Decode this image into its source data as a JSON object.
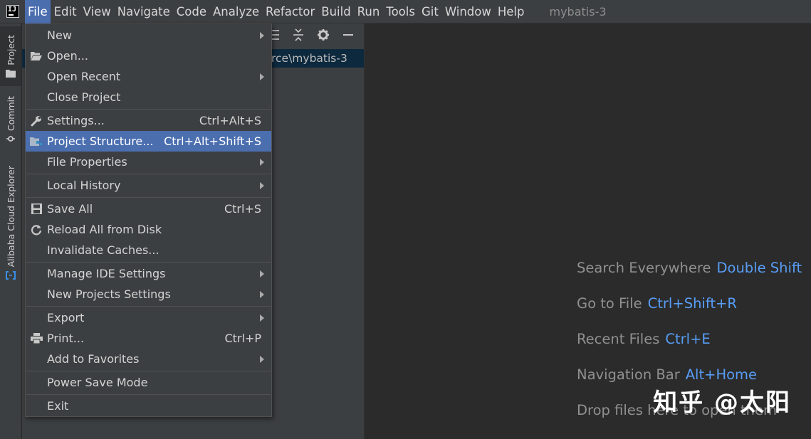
{
  "menubar": {
    "items": [
      "File",
      "Edit",
      "View",
      "Navigate",
      "Code",
      "Analyze",
      "Refactor",
      "Build",
      "Run",
      "Tools",
      "Git",
      "Window",
      "Help"
    ],
    "project_name": "mybatis-3",
    "app_icon_text": "IJ"
  },
  "left_strip": {
    "tabs": [
      "Project",
      "Commit",
      "Alibaba Cloud Explorer"
    ]
  },
  "project_panel": {
    "path_fragment": "rce\\mybatis-3",
    "toolbar_icons": [
      "expand-all-icon",
      "collapse-all-icon",
      "gear-icon",
      "minimize-icon"
    ]
  },
  "file_menu": {
    "items": [
      {
        "label": "New",
        "shortcut": "",
        "submenu": true,
        "icon": ""
      },
      {
        "label": "Open...",
        "shortcut": "",
        "submenu": false,
        "icon": "folder-open-icon"
      },
      {
        "label": "Open Recent",
        "shortcut": "",
        "submenu": true,
        "icon": ""
      },
      {
        "label": "Close Project",
        "shortcut": "",
        "submenu": false,
        "icon": ""
      },
      {
        "label": "Settings...",
        "shortcut": "Ctrl+Alt+S",
        "submenu": false,
        "icon": "wrench-icon"
      },
      {
        "label": "Project Structure...",
        "shortcut": "Ctrl+Alt+Shift+S",
        "submenu": false,
        "icon": "project-structure-icon",
        "selected": true
      },
      {
        "label": "File Properties",
        "shortcut": "",
        "submenu": true,
        "icon": ""
      },
      {
        "label": "Local History",
        "shortcut": "",
        "submenu": true,
        "icon": ""
      },
      {
        "label": "Save All",
        "shortcut": "Ctrl+S",
        "submenu": false,
        "icon": "save-icon"
      },
      {
        "label": "Reload All from Disk",
        "shortcut": "",
        "submenu": false,
        "icon": "reload-icon"
      },
      {
        "label": "Invalidate Caches...",
        "shortcut": "",
        "submenu": false,
        "icon": ""
      },
      {
        "label": "Manage IDE Settings",
        "shortcut": "",
        "submenu": true,
        "icon": ""
      },
      {
        "label": "New Projects Settings",
        "shortcut": "",
        "submenu": true,
        "icon": ""
      },
      {
        "label": "Export",
        "shortcut": "",
        "submenu": true,
        "icon": ""
      },
      {
        "label": "Print...",
        "shortcut": "Ctrl+P",
        "submenu": false,
        "icon": "printer-icon"
      },
      {
        "label": "Add to Favorites",
        "shortcut": "",
        "submenu": true,
        "icon": ""
      },
      {
        "label": "Power Save Mode",
        "shortcut": "",
        "submenu": false,
        "icon": ""
      },
      {
        "label": "Exit",
        "shortcut": "",
        "submenu": false,
        "icon": ""
      }
    ]
  },
  "editor_hints": [
    {
      "label": "Search Everywhere",
      "key": "Double Shift"
    },
    {
      "label": "Go to File",
      "key": "Ctrl+Shift+R"
    },
    {
      "label": "Recent Files",
      "key": "Ctrl+E"
    },
    {
      "label": "Navigation Bar",
      "key": "Alt+Home"
    },
    {
      "label": "Drop files here to open them",
      "key": ""
    }
  ],
  "watermark": "知乎 @太阳",
  "colors": {
    "menubar_bg": "#3c3f41",
    "selection": "#4b6eaf",
    "editor_bg": "#2b2b2b",
    "hint_key": "#589df6"
  }
}
